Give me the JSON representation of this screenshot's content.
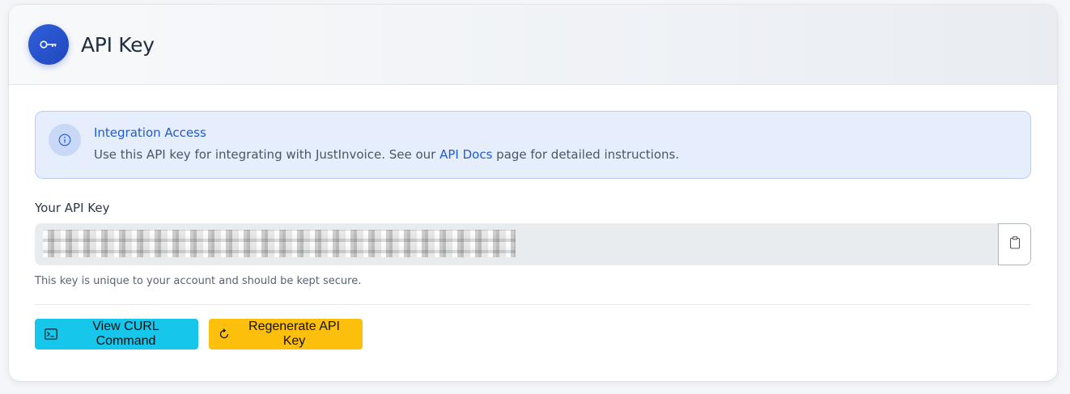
{
  "header": {
    "icon": "key-icon",
    "title": "API Key",
    "accent": "#2f5fd8"
  },
  "alert": {
    "icon": "info-icon",
    "title": "Integration Access",
    "desc_before": "Use this API key for integrating with JustInvoice. See our ",
    "link_text": "API Docs",
    "desc_after": " page for detailed instructions."
  },
  "api_key": {
    "label": "Your API Key",
    "value_state": "obscured",
    "copy_icon": "clipboard-icon",
    "help": "This key is unique to your account and should be kept secure."
  },
  "actions": {
    "curl_label": "View CURL Command",
    "curl_icon": "terminal-icon",
    "curl_color": "#16c6eb",
    "regen_label": "Regenerate API Key",
    "regen_icon": "refresh-icon",
    "regen_color": "#fbbf0c"
  }
}
